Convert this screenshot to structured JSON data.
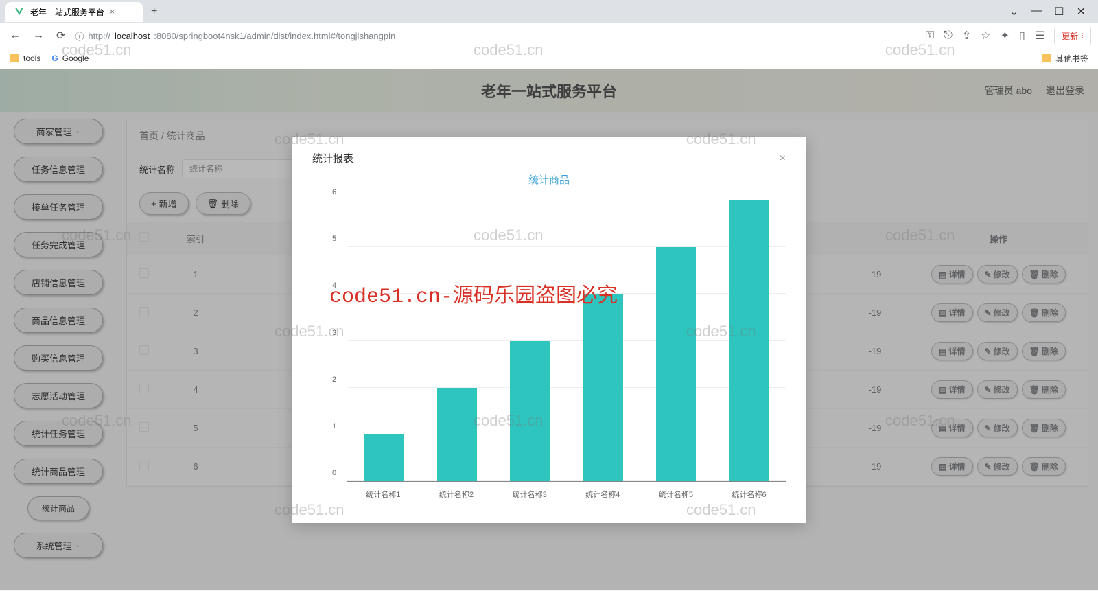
{
  "browser": {
    "tab_title": "老年一站式服务平台",
    "url_prefix": "http://",
    "url_host": "localhost",
    "url_path": ":8080/springboot4nsk1/admin/dist/index.html#/tongjishangpin",
    "update_label": "更新",
    "bookmarks": {
      "tools": "tools",
      "google": "Google",
      "other": "其他书签"
    }
  },
  "header": {
    "title": "老年一站式服务平台",
    "user": "管理员 abo",
    "logout": "退出登录"
  },
  "sidebar": {
    "items": [
      "商家管理",
      "任务信息管理",
      "接单任务管理",
      "任务完成管理",
      "店铺信息管理",
      "商品信息管理",
      "购买信息管理",
      "志愿活动管理",
      "统计任务管理",
      "统计商品管理"
    ],
    "sub_item": "统计商品",
    "last": "系统管理"
  },
  "breadcrumb": {
    "home": "首页",
    "sep": "/",
    "current": "统计商品"
  },
  "search": {
    "label": "统计名称",
    "placeholder": "统计名称"
  },
  "buttons": {
    "add": "新增",
    "delete": "删除"
  },
  "table": {
    "headers": {
      "index": "索引",
      "ops": "操作"
    },
    "date_suffix": "-19",
    "op_labels": {
      "detail": "详情",
      "edit": "修改",
      "del": "删除"
    },
    "rows": [
      "1",
      "2",
      "3",
      "4",
      "5",
      "6"
    ]
  },
  "modal": {
    "title": "统计报表",
    "chart_label": "统计商品"
  },
  "chart_data": {
    "type": "bar",
    "title": "统计商品",
    "categories": [
      "统计名称1",
      "统计名称2",
      "统计名称3",
      "统计名称4",
      "统计名称5",
      "统计名称6"
    ],
    "values": [
      1,
      2,
      3,
      4,
      5,
      6
    ],
    "xlabel": "",
    "ylabel": "",
    "ylim": [
      0,
      6
    ],
    "yticks": [
      0,
      1,
      2,
      3,
      4,
      5,
      6
    ]
  },
  "watermark": {
    "text": "code51.cn",
    "red_text": "code51.cn-源码乐园盗图必究"
  }
}
